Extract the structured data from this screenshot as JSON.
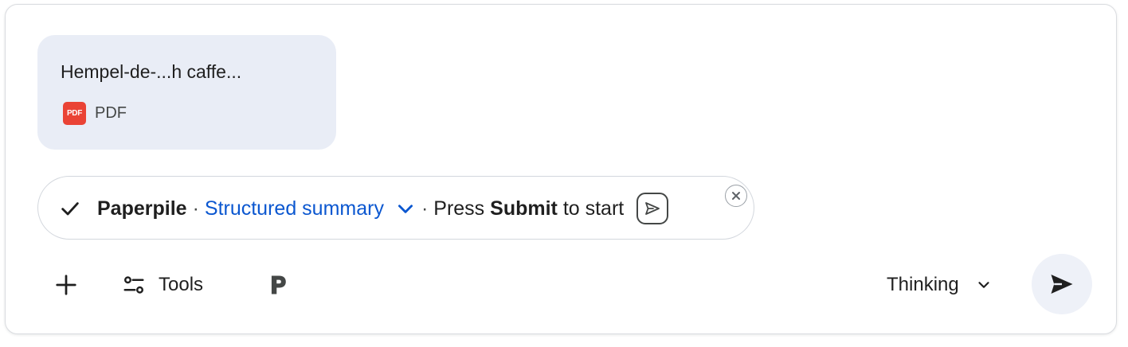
{
  "attachment": {
    "name": "Hempel-de-...h caffe...",
    "type_badge": "PDF",
    "type_label": "PDF"
  },
  "task_pill": {
    "tool_name": "Paperpile",
    "separator": "·",
    "mode": "Structured summary",
    "hint_prefix": "Press",
    "hint_bold": "Submit",
    "hint_suffix": "to start"
  },
  "toolbar": {
    "tools_label": "Tools",
    "model_label": "Thinking"
  },
  "colors": {
    "accent": "#0b57d0",
    "attachment_bg": "#e9edf6",
    "pdf_red": "#ea4335",
    "send_bg": "#eef1f8"
  },
  "icons": {
    "check": "check-icon",
    "chevron": "chevron-down-icon",
    "inline_submit": "paper-plane-icon",
    "dismiss": "close-circle-icon",
    "add": "plus-icon",
    "tools": "sliders-icon",
    "paperpile": "paperpile-logo-icon",
    "send": "send-icon"
  }
}
